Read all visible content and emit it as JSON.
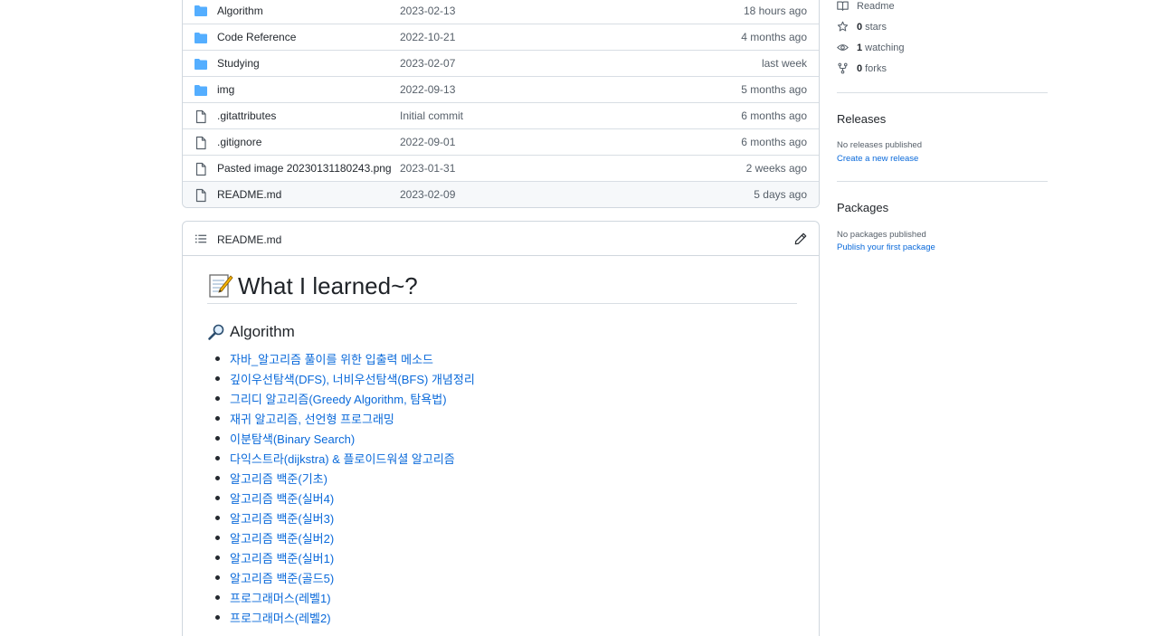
{
  "files": [
    {
      "name": "Algorithm",
      "type": "folder",
      "message": "2023-02-13",
      "age": "18 hours ago"
    },
    {
      "name": "Code Reference",
      "type": "folder",
      "message": "2022-10-21",
      "age": "4 months ago"
    },
    {
      "name": "Studying",
      "type": "folder",
      "message": "2023-02-07",
      "age": "last week"
    },
    {
      "name": "img",
      "type": "folder",
      "message": "2022-09-13",
      "age": "5 months ago"
    },
    {
      "name": ".gitattributes",
      "type": "file",
      "message": "Initial commit",
      "age": "6 months ago"
    },
    {
      "name": ".gitignore",
      "type": "file",
      "message": "2022-09-01",
      "age": "6 months ago"
    },
    {
      "name": "Pasted image 20230131180243.png",
      "type": "file",
      "message": "2023-01-31",
      "age": "2 weeks ago"
    },
    {
      "name": "README.md",
      "type": "file",
      "message": "2023-02-09",
      "age": "5 days ago"
    }
  ],
  "readme": {
    "header_title": "README.md",
    "h1": "What I learned~?",
    "h2": "Algorithm",
    "items": [
      "자바_알고리즘 풀이를 위한 입출력 메소드",
      "깊이우선탐색(DFS), 너비우선탐색(BFS) 개념정리",
      "그리디 알고리즘(Greedy Algorithm, 탐욕법)",
      "재귀 알고리즘, 선언형 프로그래밍",
      "이분탐색(Binary Search)",
      "다익스트라(dijkstra) & 플로이드워셜 알고리즘",
      "알고리즘 백준(기초)",
      "알고리즘 백준(실버4)",
      "알고리즘 백준(실버3)",
      "알고리즘 백준(실버2)",
      "알고리즘 백준(실버1)",
      "알고리즘 백준(골드5)",
      "프로그래머스(레벨1)",
      "프로그래머스(레벨2)"
    ]
  },
  "sidebar": {
    "readme_label": "Readme",
    "stars": {
      "count": "0",
      "label": "stars"
    },
    "watching": {
      "count": "1",
      "label": "watching"
    },
    "forks": {
      "count": "0",
      "label": "forks"
    },
    "releases": {
      "title": "Releases",
      "note": "No releases published",
      "link": "Create a new release"
    },
    "packages": {
      "title": "Packages",
      "note": "No packages published",
      "link": "Publish your first package"
    }
  },
  "colors": {
    "folder": "#54aeff",
    "link": "#0969da",
    "muted": "#57606a"
  }
}
